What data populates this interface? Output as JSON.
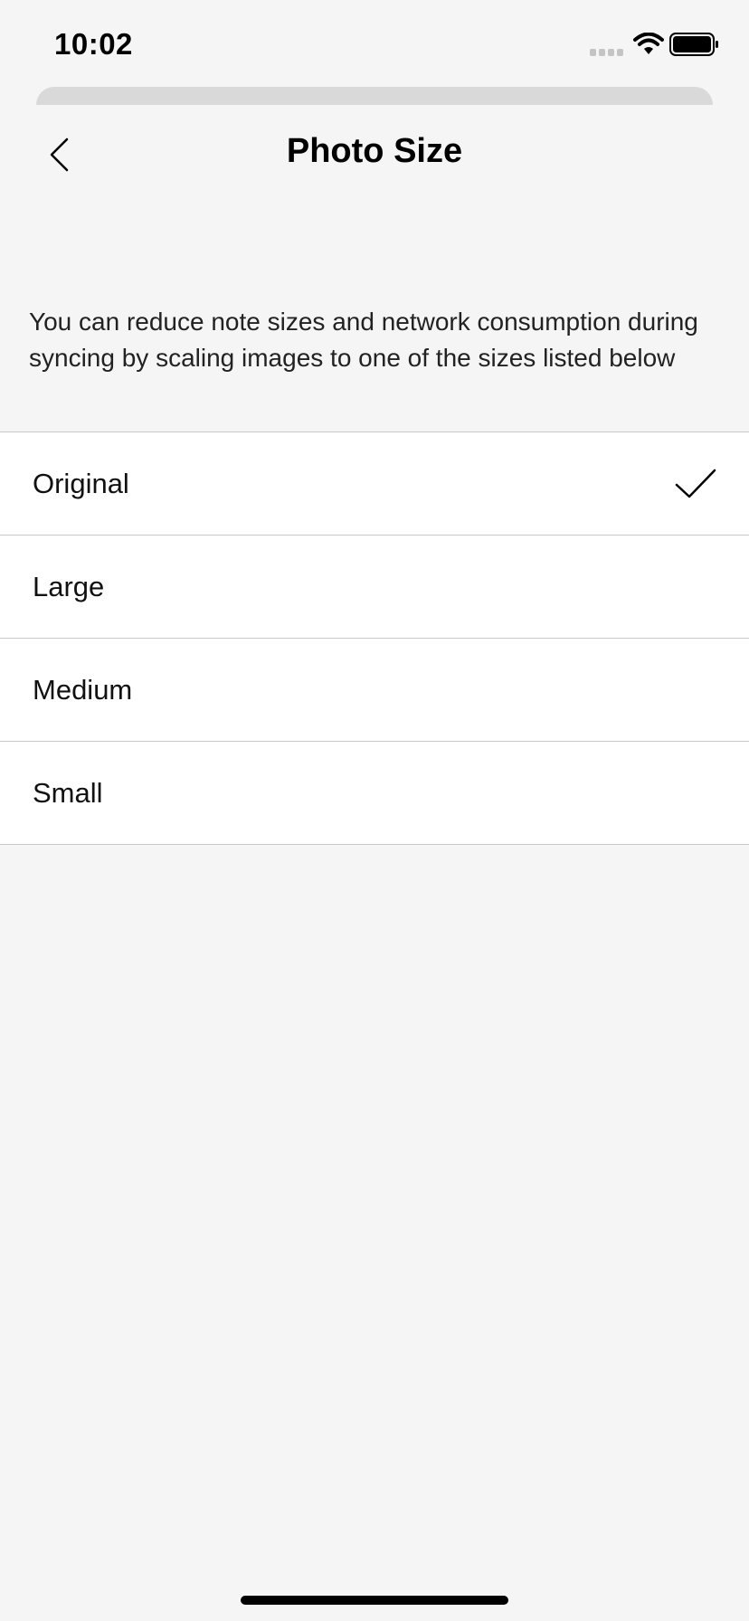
{
  "status_bar": {
    "time": "10:02"
  },
  "nav": {
    "title": "Photo Size",
    "back_icon": "chevron-left-icon"
  },
  "description": "You can reduce note sizes and network consumption during syncing by scaling images to one of the sizes listed below",
  "options": [
    {
      "label": "Original",
      "selected": true
    },
    {
      "label": "Large",
      "selected": false
    },
    {
      "label": "Medium",
      "selected": false
    },
    {
      "label": "Small",
      "selected": false
    }
  ],
  "colors": {
    "background": "#f5f5f5",
    "row_background": "#ffffff",
    "divider": "#c8c8c8"
  }
}
